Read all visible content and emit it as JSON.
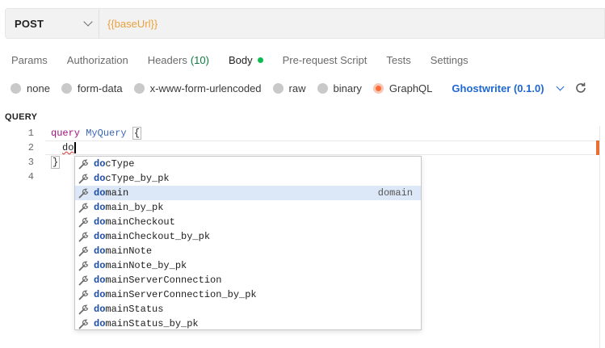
{
  "request": {
    "method": "POST",
    "url": "{{baseUrl}}"
  },
  "tabs": [
    {
      "label": "Params"
    },
    {
      "label": "Authorization"
    },
    {
      "label": "Headers",
      "count": "(10)"
    },
    {
      "label": "Body"
    },
    {
      "label": "Pre-request Script"
    },
    {
      "label": "Tests"
    },
    {
      "label": "Settings"
    }
  ],
  "body_types": [
    {
      "label": "none"
    },
    {
      "label": "form-data"
    },
    {
      "label": "x-www-form-urlencoded"
    },
    {
      "label": "raw"
    },
    {
      "label": "binary"
    },
    {
      "label": "GraphQL"
    }
  ],
  "schema": {
    "label": "Ghostwriter (0.1.0)"
  },
  "query_section": {
    "label": "QUERY"
  },
  "editor": {
    "line_numbers": [
      "1",
      "2",
      "3",
      "4"
    ],
    "line1": {
      "keyword": "query",
      "name": "MyQuery",
      "brace": "{"
    },
    "line2": {
      "typed": "do"
    },
    "line3": {
      "brace": "}"
    }
  },
  "autocomplete": {
    "match": "do",
    "items": [
      {
        "match": "do",
        "rest": "cType",
        "detail": ""
      },
      {
        "match": "do",
        "rest": "cType_by_pk",
        "detail": ""
      },
      {
        "match": "do",
        "rest": "main",
        "detail": "domain"
      },
      {
        "match": "do",
        "rest": "main_by_pk",
        "detail": ""
      },
      {
        "match": "do",
        "rest": "mainCheckout",
        "detail": ""
      },
      {
        "match": "do",
        "rest": "mainCheckout_by_pk",
        "detail": ""
      },
      {
        "match": "do",
        "rest": "mainNote",
        "detail": ""
      },
      {
        "match": "do",
        "rest": "mainNote_by_pk",
        "detail": ""
      },
      {
        "match": "do",
        "rest": "mainServerConnection",
        "detail": ""
      },
      {
        "match": "do",
        "rest": "mainServerConnection_by_pk",
        "detail": ""
      },
      {
        "match": "do",
        "rest": "mainStatus",
        "detail": ""
      },
      {
        "match": "do",
        "rest": "mainStatus_by_pk",
        "detail": ""
      }
    ],
    "item_icon": "wrench-icon"
  },
  "colors": {
    "accent": "#ff6c37",
    "link": "#1f67d3",
    "url": "#e9a13b",
    "body_dot": "#0cbb52"
  }
}
